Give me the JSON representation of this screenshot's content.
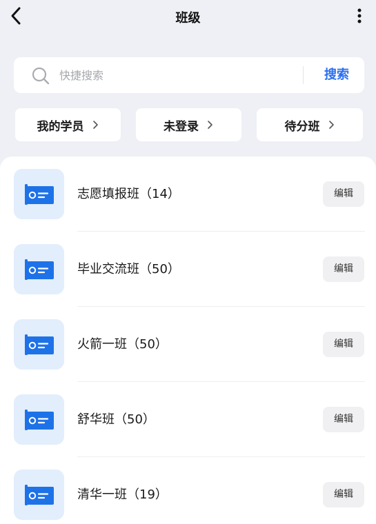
{
  "header": {
    "title": "班级",
    "back_icon": "chevron-left-icon",
    "more_icon": "more-vertical-icon"
  },
  "search": {
    "placeholder": "快捷搜索",
    "value": "",
    "button_label": "搜索",
    "icon": "search-icon"
  },
  "filters": [
    {
      "label": "我的学员"
    },
    {
      "label": "未登录"
    },
    {
      "label": "待分班"
    }
  ],
  "classes": [
    {
      "name": "志愿填报班（14）",
      "edit_label": "编辑"
    },
    {
      "name": "毕业交流班（50）",
      "edit_label": "编辑"
    },
    {
      "name": "火箭一班（50）",
      "edit_label": "编辑"
    },
    {
      "name": "舒华班（50）",
      "edit_label": "编辑"
    },
    {
      "name": "清华一班（19）",
      "edit_label": "编辑"
    }
  ],
  "colors": {
    "accent": "#2a6ff0",
    "icon_blue": "#1e72e8",
    "icon_bg": "#e2eefc",
    "page_bg": "#eef0f5"
  }
}
